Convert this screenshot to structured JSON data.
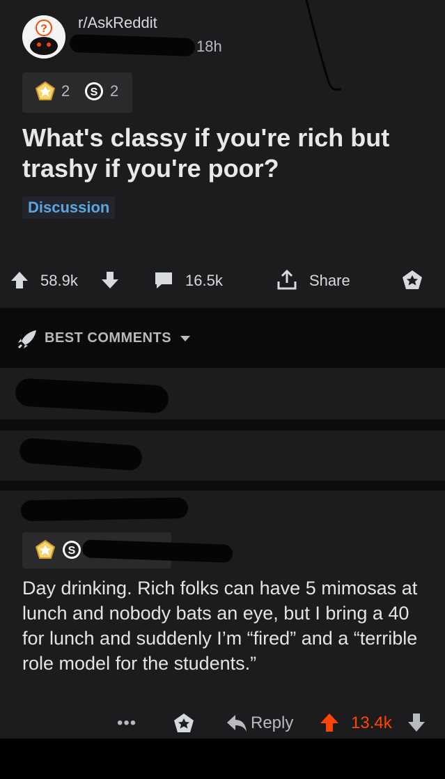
{
  "post": {
    "subreddit": "r/AskReddit",
    "time": "18h",
    "awards": [
      {
        "icon": "silver-award-icon",
        "count": "2"
      },
      {
        "icon": "coin-icon",
        "count": "2"
      }
    ],
    "title": "What's classy if you're rich but trashy if you're poor?",
    "flair": "Discussion",
    "upvotes": "58.9k",
    "comments": "16.5k",
    "share_label": "Share"
  },
  "sort": {
    "label": "BEST COMMENTS"
  },
  "comment": {
    "body": "Day drinking. Rich folks can have 5 mimosas at lunch and nobody bats an eye, but I bring a 40 for lunch and suddenly I’m “fired” and a “terrible role model for the students.”",
    "more": "•••",
    "reply_label": "Reply",
    "upvotes": "13.4k"
  },
  "colors": {
    "background": "#1c1c1e",
    "upvote": "#ff4500",
    "flair": "#5ba6e0"
  }
}
